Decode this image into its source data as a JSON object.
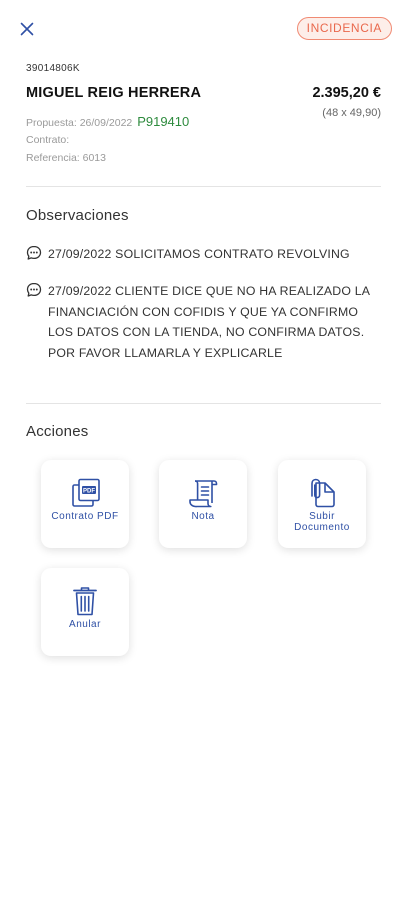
{
  "header": {
    "status_badge": "INCIDENCIA",
    "colors": {
      "badge_text": "#e9684c",
      "badge_bg": "#fdeee9",
      "accent": "#2f50a5",
      "code_green": "#2e8b3e"
    }
  },
  "client": {
    "id": "39014806K",
    "name": "MIGUEL REIG HERRERA",
    "amount": "2.395,20 €",
    "installments": "(48 x 49,90)",
    "proposal_label": "Propuesta: 26/09/2022",
    "proposal_code": "P919410",
    "contract_label": "Contrato:",
    "reference_label": "Referencia: 6013"
  },
  "observations": {
    "title": "Observaciones",
    "items": [
      {
        "icon": "chat-bubble-icon",
        "text": "27/09/2022 SOLICITAMOS CONTRATO REVOLVING"
      },
      {
        "icon": "chat-bubble-icon",
        "text": "27/09/2022 CLIENTE DICE QUE NO HA REALIZADO LA FINANCIACIÓN CON COFIDIS Y QUE YA CONFIRMO LOS DATOS CON LA TIENDA, NO CONFIRMA DATOS. POR FAVOR LLAMARLA Y EXPLICARLE"
      }
    ]
  },
  "actions": {
    "title": "Acciones",
    "items": [
      {
        "icon": "pdf-document-icon",
        "label": "Contrato PDF"
      },
      {
        "icon": "note-scroll-icon",
        "label": "Nota"
      },
      {
        "icon": "upload-document-icon",
        "label": "Subir Documento"
      },
      {
        "icon": "trash-icon",
        "label": "Anular"
      }
    ]
  }
}
